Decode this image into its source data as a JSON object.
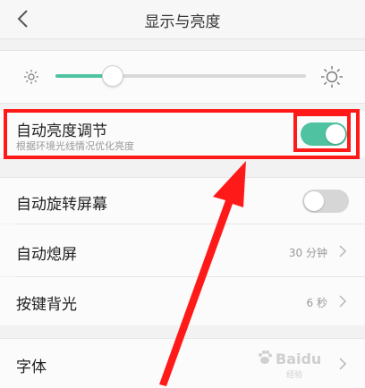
{
  "header": {
    "title": "显示与亮度",
    "back_icon": "back-chevron-icon"
  },
  "brightness": {
    "level": 0.23,
    "min_icon": "sun-small-icon",
    "max_icon": "sun-large-icon",
    "accent": "#4fc3a1"
  },
  "auto_brightness": {
    "label": "自动亮度调节",
    "description": "根据环境光线情况优化亮度",
    "enabled": true
  },
  "rows": [
    {
      "label": "自动旋转屏幕",
      "toggle": false
    },
    {
      "label": "自动熄屏",
      "value": "30 分钟"
    },
    {
      "label": "按键背光",
      "value": "6 秒"
    },
    {
      "label": "字体"
    }
  ],
  "annotation": {
    "color": "#ff1a1a"
  },
  "watermark": {
    "text": "Baidu",
    "sub": "经验"
  }
}
